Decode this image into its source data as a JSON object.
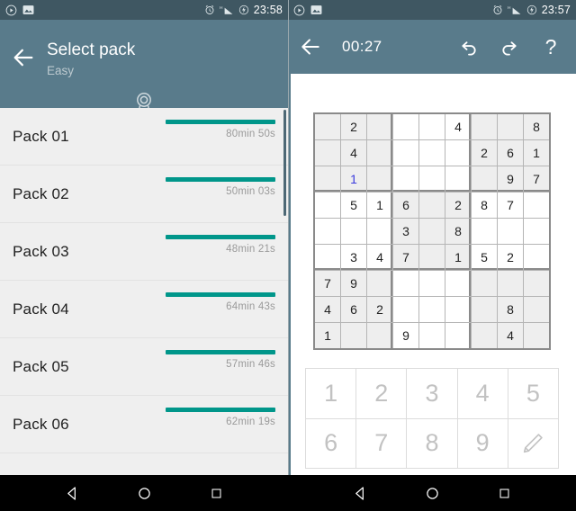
{
  "left_panel": {
    "status_bar": {
      "icons_left": [
        "play-circle-icon",
        "image-icon"
      ],
      "icons_right": [
        "alarm-icon",
        "signal-h-icon",
        "battery-charging-icon"
      ],
      "time": "23:58"
    },
    "app_bar": {
      "back_icon": "back-arrow-icon",
      "title": "Select pack",
      "subtitle": "Easy",
      "medal_icon": "award-medal-icon"
    },
    "packs": [
      {
        "name": "Pack 01",
        "time": "80min 50s",
        "progress": 100
      },
      {
        "name": "Pack 02",
        "time": "50min 03s",
        "progress": 100
      },
      {
        "name": "Pack 03",
        "time": "48min 21s",
        "progress": 100
      },
      {
        "name": "Pack 04",
        "time": "64min 43s",
        "progress": 100
      },
      {
        "name": "Pack 05",
        "time": "57min 46s",
        "progress": 100
      },
      {
        "name": "Pack 06",
        "time": "62min 19s",
        "progress": 100
      }
    ],
    "nav_bar": {
      "back": "nav-back-triangle",
      "home": "nav-home-circle",
      "recents": "nav-recents-square"
    }
  },
  "right_panel": {
    "status_bar": {
      "icons_left": [
        "play-circle-icon",
        "image-icon"
      ],
      "icons_right": [
        "alarm-icon",
        "signal-h-icon",
        "battery-charging-icon"
      ],
      "time": "23:57"
    },
    "app_bar": {
      "back_icon": "back-arrow-icon",
      "timer": "00:27",
      "undo_icon": "undo-icon",
      "redo_icon": "redo-icon",
      "help_label": "?"
    },
    "sudoku": {
      "rows": [
        [
          "",
          "2",
          "",
          "",
          "",
          "4",
          "",
          "",
          "8"
        ],
        [
          "",
          "4",
          "",
          "",
          "",
          "",
          "2",
          "6",
          "1"
        ],
        [
          "",
          "1",
          "",
          "",
          "",
          "",
          "",
          "9",
          "7"
        ],
        [
          "",
          "5",
          "1",
          "6",
          "",
          "2",
          "8",
          "7",
          ""
        ],
        [
          "",
          "",
          "",
          "3",
          "",
          "8",
          "",
          "",
          ""
        ],
        [
          "",
          "3",
          "4",
          "7",
          "",
          "1",
          "5",
          "2",
          ""
        ],
        [
          "7",
          "9",
          "",
          "",
          "",
          "",
          "",
          "",
          ""
        ],
        [
          "4",
          "6",
          "2",
          "",
          "",
          "",
          "",
          "8",
          ""
        ],
        [
          "1",
          "",
          "",
          "9",
          "",
          "",
          "",
          "4",
          ""
        ]
      ],
      "user_entered": [
        [
          2,
          1
        ]
      ],
      "shaded_boxes": [
        0,
        2,
        4,
        6,
        8
      ]
    },
    "numpad": {
      "keys": [
        "1",
        "2",
        "3",
        "4",
        "5",
        "6",
        "7",
        "8",
        "9"
      ],
      "pencil_icon": "pencil-icon"
    },
    "nav_bar": {
      "back": "nav-back-triangle",
      "home": "nav-home-circle",
      "recents": "nav-recents-square"
    }
  },
  "colors": {
    "app_bar": "#597b8b",
    "status_bar": "#3f5762",
    "progress": "#00968a",
    "list_bg": "#efefef",
    "user_digit": "#3b3bdd",
    "cell_shaded": "#eeeeee"
  }
}
